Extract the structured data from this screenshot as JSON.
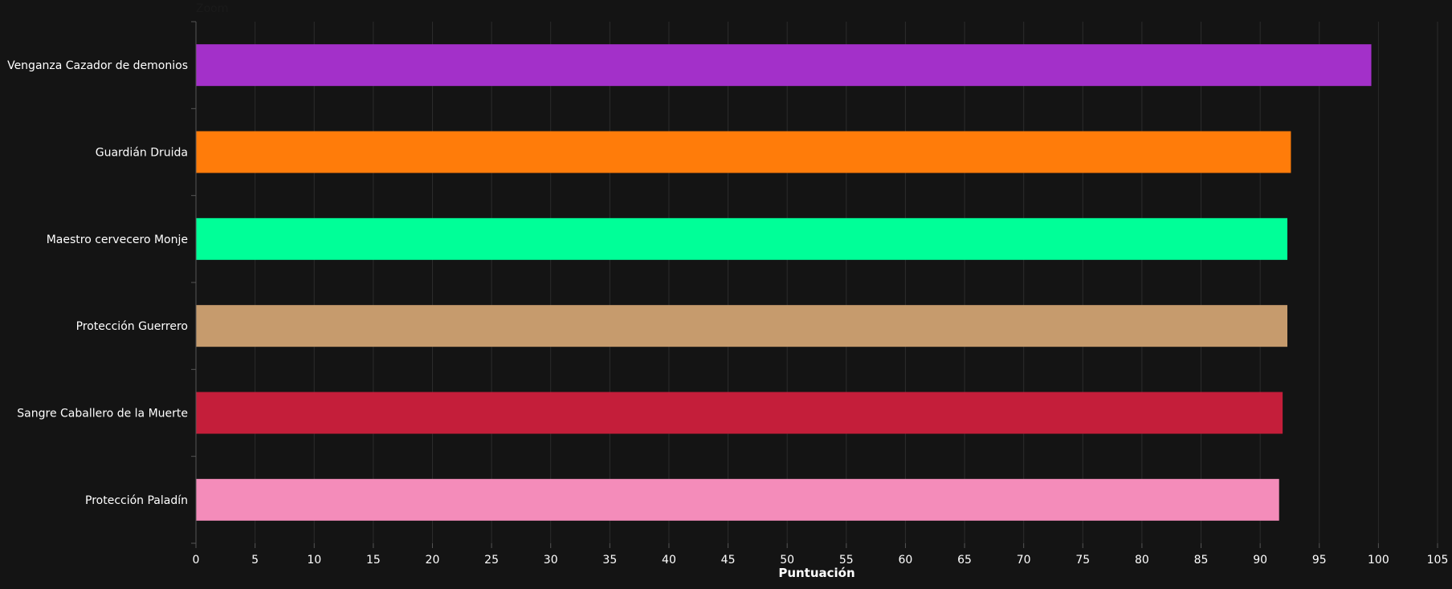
{
  "zoom_label": "Zoom",
  "chart_data": {
    "type": "bar",
    "orientation": "horizontal",
    "title": "",
    "xlabel": "Puntuación",
    "ylabel": "",
    "xlim": [
      0,
      105
    ],
    "xticks": [
      0,
      5,
      10,
      15,
      20,
      25,
      30,
      35,
      40,
      45,
      50,
      55,
      60,
      65,
      70,
      75,
      80,
      85,
      90,
      95,
      100,
      105
    ],
    "grid": true,
    "categories": [
      "Venganza Cazador de demonios",
      "Guardián Druida",
      "Maestro cervecero Monje",
      "Protección Guerrero",
      "Sangre Caballero de la Muerte",
      "Protección Paladín"
    ],
    "values": [
      99.4,
      92.6,
      92.3,
      92.3,
      91.9,
      91.6
    ],
    "colors": [
      "#a330c9",
      "#ff7c0a",
      "#00ff98",
      "#c69b6d",
      "#c41e3a",
      "#f48cba"
    ]
  }
}
